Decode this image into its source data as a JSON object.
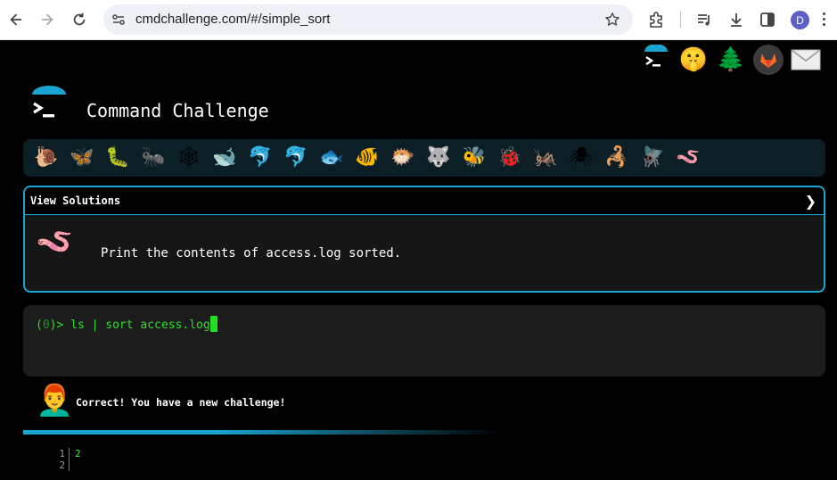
{
  "browser": {
    "url": "cmdchallenge.com/#/simple_sort",
    "profile_initial": "D"
  },
  "header": {
    "title": "Command Challenge"
  },
  "animals": [
    {
      "glyph": "🐌",
      "name": "snail"
    },
    {
      "glyph": "🦋",
      "name": "butterfly"
    },
    {
      "glyph": "🐛",
      "name": "caterpillar"
    },
    {
      "glyph": "🐜",
      "name": "ant"
    },
    {
      "glyph": "🕸",
      "name": "web"
    },
    {
      "glyph": "🐋",
      "name": "whale"
    },
    {
      "glyph": "🐬",
      "name": "dolphin"
    },
    {
      "glyph": "🐬",
      "name": "dolphin-grey"
    },
    {
      "glyph": "🐟",
      "name": "fish"
    },
    {
      "glyph": "🐠",
      "name": "tropical-fish"
    },
    {
      "glyph": "🐡",
      "name": "pufferfish"
    },
    {
      "glyph": "🐺",
      "name": "wolf"
    },
    {
      "glyph": "🐝",
      "name": "bee"
    },
    {
      "glyph": "🐞",
      "name": "ladybug"
    },
    {
      "glyph": "🦗",
      "name": "cricket"
    },
    {
      "glyph": "🕷",
      "name": "spider"
    },
    {
      "glyph": "🦂",
      "name": "scorpion"
    },
    {
      "glyph": "🪰",
      "name": "fly"
    },
    {
      "glyph": "🪱",
      "name": "worm"
    }
  ],
  "solutions": {
    "label": "View Solutions",
    "chevron": "❯",
    "task": "Print the contents of access.log sorted."
  },
  "terminal": {
    "prompt_open": "(",
    "prompt_num": "0",
    "prompt_close": ")> ",
    "command": "ls | sort access.log"
  },
  "result": {
    "message": "Correct! You have a new challenge!"
  },
  "output": {
    "line_numbers": "1\n2",
    "text": "2"
  },
  "colors": {
    "accent": "#1aa5d0",
    "terminal_green": "#33dd33"
  }
}
